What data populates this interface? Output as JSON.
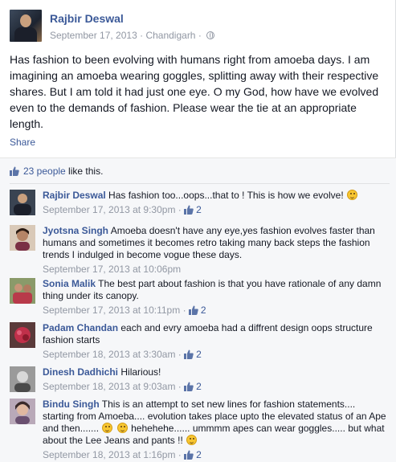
{
  "post": {
    "author": "Rajbir Deswal",
    "date": "September 17, 2013",
    "location": "Chandigarh",
    "separator": "·",
    "text": "Has fashion to been evolving with humans right from amoeba days. I am imagining an amoeba wearing goggles, splitting away with their respective shares. But I am told it had just one eye. O my God, how have we evolved even to the demands of fashion. Please wear the tie at an appropriate length.",
    "share_label": "Share"
  },
  "likes": {
    "count_text": "23 people",
    "suffix": " like this."
  },
  "comments": [
    {
      "author": "Rajbir Deswal",
      "text": "Has fashion too...oops...that to ! This is how we evolve!",
      "time": "September 17, 2013 at 9:30pm",
      "likes": "2",
      "emoji_end": true,
      "extra_text": "",
      "tail_text": ""
    },
    {
      "author": "Jyotsna Singh",
      "text": "Amoeba doesn't have any eye,yes fashion evolves faster than humans and sometimes it becomes retro taking many back steps the fashion trends I indulged in become vogue these days.",
      "time": "September 17, 2013 at 10:06pm",
      "likes": "",
      "emoji_end": false,
      "extra_text": "",
      "tail_text": ""
    },
    {
      "author": "Sonia Malik",
      "text": "The best part about fashion is that you have rationale of any damn thing under its canopy.",
      "time": "September 17, 2013 at 10:11pm",
      "likes": "2",
      "emoji_end": false,
      "extra_text": "",
      "tail_text": ""
    },
    {
      "author": "Padam Chandan",
      "text": "each and evry amoeba had a diffrent design oops structure fashion starts",
      "time": "September 18, 2013 at 3:30am",
      "likes": "2",
      "emoji_end": false,
      "extra_text": "",
      "tail_text": ""
    },
    {
      "author": "Dinesh Dadhichi",
      "text": "Hilarious!",
      "time": "September 18, 2013 at 9:03am",
      "likes": "2",
      "emoji_end": false,
      "extra_text": "",
      "tail_text": ""
    },
    {
      "author": "Bindu Singh",
      "text": "This is an attempt to set new lines for fashion statements.... starting from Amoeba.... evolution takes place upto the elevated status of an Ape and then.......",
      "extra_text": "hehehehe...... ummmm apes can wear goggles..... but what about the Lee Jeans and pants !!",
      "tail_text": "",
      "time": "September 18, 2013 at 1:16pm",
      "likes": "2",
      "emoji_end": true
    }
  ]
}
